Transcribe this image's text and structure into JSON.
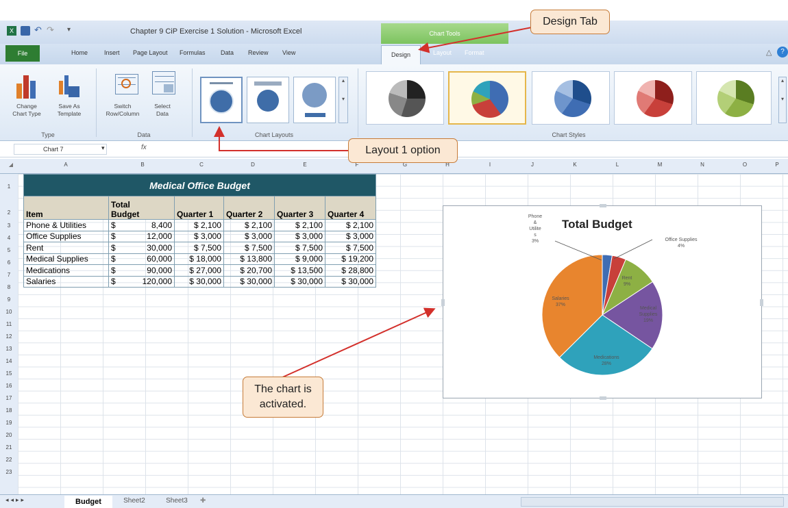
{
  "window": {
    "title": "Chapter 9 CiP Exercise 1 Solution - Microsoft Excel",
    "contextual_group": "Chart Tools"
  },
  "ribbon_tabs": [
    "File",
    "Home",
    "Insert",
    "Page Layout",
    "Formulas",
    "Data",
    "Review",
    "View",
    "Design",
    "Layout",
    "Format"
  ],
  "ribbon_groups": {
    "type": {
      "label": "Type",
      "buttons": [
        {
          "label": "Change Chart Type",
          "line1": "Change",
          "line2": "Chart Type",
          "icon": "change-chart-type-icon"
        },
        {
          "label": "Save As Template",
          "line1": "Save As",
          "line2": "Template",
          "icon": "save-as-template-icon"
        }
      ]
    },
    "data": {
      "label": "Data",
      "buttons": [
        {
          "label": "Switch Row/Column",
          "line1": "Switch",
          "line2": "Row/Column",
          "icon": "switch-row-column-icon"
        },
        {
          "label": "Select Data",
          "line1": "Select",
          "line2": "Data",
          "icon": "select-data-icon"
        }
      ]
    },
    "chart_layouts": {
      "label": "Chart Layouts"
    },
    "chart_styles": {
      "label": "Chart Styles"
    }
  },
  "formula_bar": {
    "name_box": "Chart 7",
    "fx": "fx",
    "formula": ""
  },
  "columns": [
    "A",
    "B",
    "C",
    "D",
    "E",
    "F",
    "G",
    "H",
    "I",
    "J",
    "K",
    "L",
    "M",
    "N",
    "O",
    "P"
  ],
  "rows": [
    "1",
    "2",
    "3",
    "4",
    "5",
    "6",
    "7",
    "8",
    "9",
    "10",
    "11",
    "12",
    "13",
    "14",
    "15",
    "16",
    "17",
    "18",
    "19",
    "20",
    "21",
    "22",
    "23"
  ],
  "table": {
    "title": "Medical Office Budget",
    "headers": [
      "Item",
      "Total Budget",
      "Quarter 1",
      "Quarter 2",
      "Quarter 3",
      "Quarter 4"
    ],
    "header_total_line1": "Total",
    "header_total_line2": "Budget",
    "rows": [
      [
        "Phone & Utilities",
        "$",
        "8,400",
        "$ 2,100",
        "$ 2,100",
        "$ 2,100",
        "$ 2,100"
      ],
      [
        "Office Supplies",
        "$",
        "12,000",
        "$ 3,000",
        "$ 3,000",
        "$ 3,000",
        "$ 3,000"
      ],
      [
        "Rent",
        "$",
        "30,000",
        "$ 7,500",
        "$ 7,500",
        "$ 7,500",
        "$ 7,500"
      ],
      [
        "Medical Supplies",
        "$",
        "60,000",
        "$ 18,000",
        "$ 13,800",
        "$ 9,000",
        "$ 19,200"
      ],
      [
        "Medications",
        "$",
        "90,000",
        "$ 27,000",
        "$ 20,700",
        "$ 13,500",
        "$ 28,800"
      ],
      [
        "Salaries",
        "$",
        "120,000",
        "$ 30,000",
        "$ 30,000",
        "$ 30,000",
        "$ 30,000"
      ]
    ]
  },
  "chart_data": {
    "type": "pie",
    "title": "Total Budget",
    "categories": [
      "Phone & Utilities",
      "Office Supplies",
      "Rent",
      "Medical Supplies",
      "Medications",
      "Salaries"
    ],
    "values": [
      8400,
      12000,
      30000,
      60000,
      90000,
      120000
    ],
    "percent_labels": [
      "3%",
      "4%",
      "9%",
      "19%",
      "28%",
      "37%"
    ],
    "colors": [
      "#3f6db3",
      "#c8403a",
      "#8db044",
      "#7655a0",
      "#2fa2bb",
      "#e8852e"
    ]
  },
  "pie_labels": {
    "phone": [
      "Phone",
      "&",
      "Utilite",
      "s",
      "3%"
    ],
    "office": [
      "Office Supplies",
      "4%"
    ],
    "rent": [
      "Rent",
      "9%"
    ],
    "medical": [
      "Medical",
      "Supplies",
      "19%"
    ],
    "medications": [
      "Medications",
      "28%"
    ],
    "salaries": [
      "Salaries",
      "37%"
    ]
  },
  "callouts": {
    "design_tab": "Design Tab",
    "layout1": "Layout 1 option",
    "chart_activated_line1": "The chart is",
    "chart_activated_line2": "activated."
  },
  "sheet_tabs": [
    "Budget",
    "Sheet2",
    "Sheet3"
  ]
}
